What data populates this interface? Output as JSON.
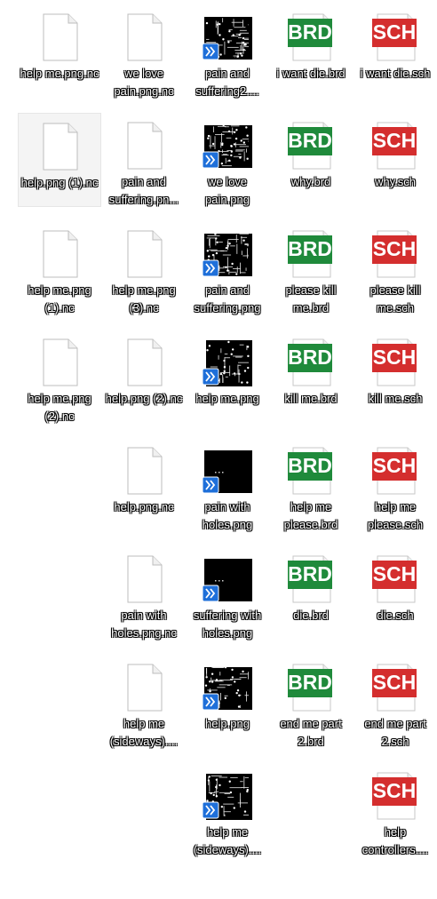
{
  "desktop": {
    "items": [
      {
        "type": "nc",
        "label": "help me.png.nc",
        "selected": false,
        "col": 0,
        "row": 0
      },
      {
        "type": "nc",
        "label": "we love pain.png.nc",
        "selected": false,
        "col": 1,
        "row": 0
      },
      {
        "type": "png",
        "label": "pain and suffering2....",
        "selected": false,
        "col": 2,
        "row": 0,
        "pattern": "dense"
      },
      {
        "type": "brd",
        "label": "i want die.brd",
        "selected": false,
        "col": 3,
        "row": 0
      },
      {
        "type": "sch",
        "label": "i want die.sch",
        "selected": false,
        "col": 4,
        "row": 0
      },
      {
        "type": "nc",
        "label": "help.png (1).nc",
        "selected": true,
        "col": 0,
        "row": 1
      },
      {
        "type": "nc",
        "label": "pain and suffering.pn...",
        "selected": false,
        "col": 1,
        "row": 1
      },
      {
        "type": "png",
        "label": "we love pain.png",
        "selected": false,
        "col": 2,
        "row": 1,
        "pattern": "dense"
      },
      {
        "type": "brd",
        "label": "why.brd",
        "selected": false,
        "col": 3,
        "row": 1
      },
      {
        "type": "sch",
        "label": "why.sch",
        "selected": false,
        "col": 4,
        "row": 1
      },
      {
        "type": "nc",
        "label": "help me.png (1).nc",
        "selected": false,
        "col": 0,
        "row": 2
      },
      {
        "type": "nc",
        "label": "help me.png (3).nc",
        "selected": false,
        "col": 1,
        "row": 2
      },
      {
        "type": "png",
        "label": "pain and suffering.png",
        "selected": false,
        "col": 2,
        "row": 2,
        "pattern": "dense"
      },
      {
        "type": "brd",
        "label": "please kill me.brd",
        "selected": false,
        "col": 3,
        "row": 2
      },
      {
        "type": "sch",
        "label": "please kill me.sch",
        "selected": false,
        "col": 4,
        "row": 2
      },
      {
        "type": "nc",
        "label": "help me.png (2).nc",
        "selected": false,
        "col": 0,
        "row": 3
      },
      {
        "type": "nc",
        "label": "help.png (2).nc",
        "selected": false,
        "col": 1,
        "row": 3
      },
      {
        "type": "png",
        "label": "help me.png",
        "selected": false,
        "col": 2,
        "row": 3,
        "pattern": "tall"
      },
      {
        "type": "brd",
        "label": "kill me.brd",
        "selected": false,
        "col": 3,
        "row": 3
      },
      {
        "type": "sch",
        "label": "kill me.sch",
        "selected": false,
        "col": 4,
        "row": 3
      },
      {
        "type": "nc",
        "label": "help.png.nc",
        "selected": false,
        "col": 1,
        "row": 4
      },
      {
        "type": "png",
        "label": "pain with holes.png",
        "selected": false,
        "col": 2,
        "row": 4,
        "pattern": "holes"
      },
      {
        "type": "brd",
        "label": "help me please.brd",
        "selected": false,
        "col": 3,
        "row": 4
      },
      {
        "type": "sch",
        "label": "help me please.sch",
        "selected": false,
        "col": 4,
        "row": 4
      },
      {
        "type": "nc",
        "label": "pain with holes.png.nc",
        "selected": false,
        "col": 1,
        "row": 5
      },
      {
        "type": "png",
        "label": "suffering with holes.png",
        "selected": false,
        "col": 2,
        "row": 5,
        "pattern": "holes"
      },
      {
        "type": "brd",
        "label": "die.brd",
        "selected": false,
        "col": 3,
        "row": 5
      },
      {
        "type": "sch",
        "label": "die.sch",
        "selected": false,
        "col": 4,
        "row": 5
      },
      {
        "type": "nc",
        "label": "help me (sideways)....",
        "selected": false,
        "col": 1,
        "row": 6
      },
      {
        "type": "png",
        "label": "help.png",
        "selected": false,
        "col": 2,
        "row": 6,
        "pattern": "wide"
      },
      {
        "type": "brd",
        "label": "end me part 2.brd",
        "selected": false,
        "col": 3,
        "row": 6
      },
      {
        "type": "sch",
        "label": "end me part 2.sch",
        "selected": false,
        "col": 4,
        "row": 6
      },
      {
        "type": "png",
        "label": "help me (sideways)....",
        "selected": false,
        "col": 2,
        "row": 7,
        "pattern": "tall"
      },
      {
        "type": "sch",
        "label": "help controllers....",
        "selected": false,
        "col": 4,
        "row": 7
      }
    ]
  },
  "icons": {
    "brd": {
      "text": "BRD",
      "color": "#1f8a3b",
      "icon_name": "brd-file-icon"
    },
    "sch": {
      "text": "SCH",
      "color": "#d42e2e",
      "icon_name": "sch-file-icon"
    },
    "nc": {
      "icon_name": "blank-file-icon"
    },
    "png": {
      "icon_name": "pcb-image-thumbnail",
      "badge_icon": "shortcut-arrow-icon",
      "badge_color": "#1e6fd9"
    }
  }
}
